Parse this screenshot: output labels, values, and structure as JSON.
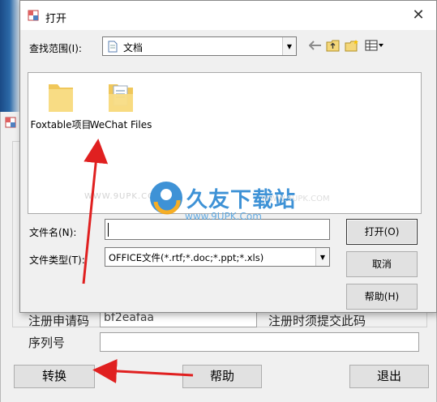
{
  "dialog": {
    "title": "打开",
    "close_glyph": "✕",
    "look_in_label": "查找范围(I):",
    "look_in_value": "文档",
    "files": [
      {
        "name": "Foxtable项目",
        "icon": "folder-icon"
      },
      {
        "name": "WeChat Files",
        "icon": "folder-documents-icon"
      }
    ],
    "filename_label": "文件名(N):",
    "filename_value": "",
    "filetype_label": "文件类型(T):",
    "filetype_value": "OFFICE文件(*.rtf;*.doc;*.ppt;*.xls)",
    "buttons": {
      "open": "打开(O)",
      "cancel": "取消",
      "help": "帮助(H)"
    },
    "toolbar": [
      "back-arrow-icon",
      "up-folder-icon",
      "new-folder-icon",
      "view-menu-icon"
    ]
  },
  "background_window": {
    "reg_code_label": "注册申请码",
    "reg_code_value": "bf2eafaa",
    "reg_code_hint": "注册时须提交此码",
    "serial_label": "序列号",
    "serial_value": "",
    "buttons": {
      "convert": "转换",
      "help": "帮助",
      "exit": "退出"
    }
  },
  "watermark": {
    "url_left": "WWW.9UPK.COM",
    "title": "久友下载站",
    "url": "www.9UPK.Com",
    "url_right": "WWW.9UPK.COM"
  },
  "colors": {
    "arrow": "#e02020",
    "watermark_blue": "#1d7fd0",
    "watermark_orange": "#f5a000"
  }
}
